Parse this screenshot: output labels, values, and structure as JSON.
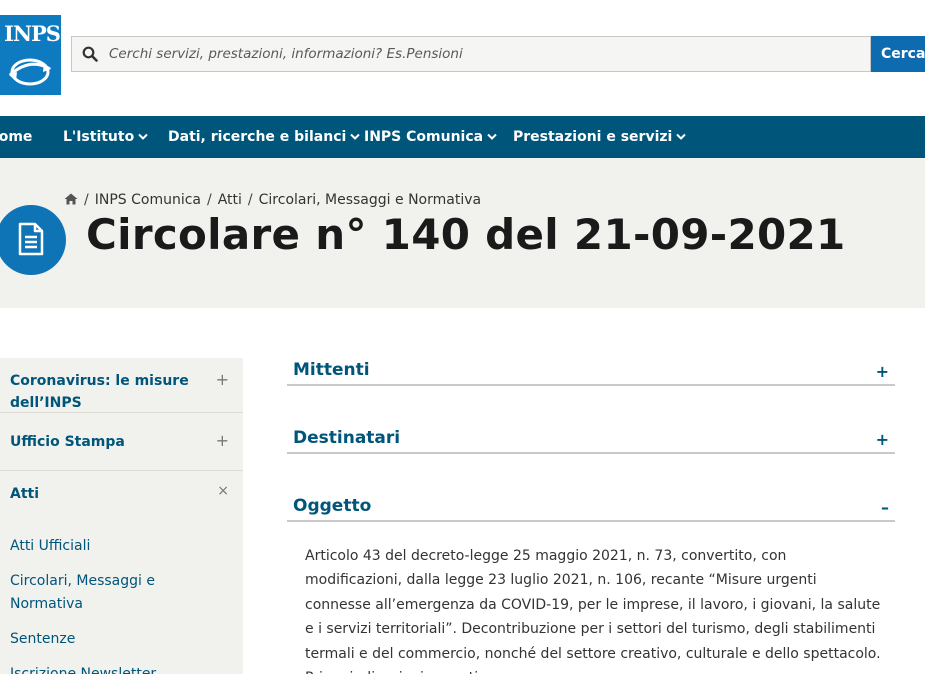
{
  "header": {
    "logo_text": "INPS",
    "search_placeholder": "Cerchi servizi, prestazioni, informazioni? Es.Pensioni",
    "search_button": "Cerca"
  },
  "nav": {
    "items": [
      {
        "label": "Home"
      },
      {
        "label": "L'Istituto"
      },
      {
        "label": "Dati, ricerche e bilanci"
      },
      {
        "label": "INPS Comunica"
      },
      {
        "label": "Prestazioni e servizi"
      }
    ]
  },
  "breadcrumb": [
    "INPS Comunica",
    "Atti",
    "Circolari, Messaggi e Normativa"
  ],
  "page_title": "Circolare n° 140 del 21-09-2021",
  "sidebar": {
    "sections": [
      {
        "label": "Coronavirus: le misure dell’INPS",
        "toggle": "+"
      },
      {
        "label": "Ufficio Stampa",
        "toggle": "+"
      },
      {
        "label": "Atti",
        "toggle": "×"
      }
    ],
    "links": [
      "Atti Ufficiali",
      "Circolari, Messaggi e Normativa",
      "Sentenze",
      "Iscrizione Newsletter"
    ]
  },
  "accordion": [
    {
      "title": "Mittenti",
      "toggle": "+"
    },
    {
      "title": "Destinatari",
      "toggle": "+"
    },
    {
      "title": "Oggetto",
      "toggle": "–"
    }
  ],
  "oggetto_text": "Articolo 43 del decreto-legge 25 maggio 2021, n. 73, convertito, con modificazioni, dalla legge 23 luglio 2021, n. 106, recante “Misure urgenti connesse all’emergenza da COVID-19, per le imprese, il lavoro, i giovani, la salute e i servizi territoriali”. Decontribuzione per i settori del turismo, degli stabilimenti termali e del commercio, nonché del settore creativo, culturale e dello spettacolo. Prime indicazioni operative",
  "colors": {
    "nav": "#00557a",
    "brand": "#0e7bc1",
    "band": "#f1f1ee"
  }
}
